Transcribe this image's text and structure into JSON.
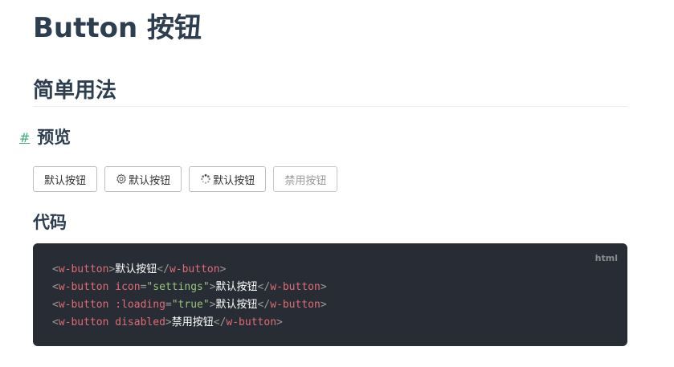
{
  "title": "Button 按钮",
  "section": {
    "heading": "简单用法",
    "preview": {
      "anchor": "#",
      "heading": "预览",
      "buttons": [
        {
          "label": "默认按钮",
          "icon": null,
          "disabled": false
        },
        {
          "label": "默认按钮",
          "icon": "settings-icon",
          "disabled": false
        },
        {
          "label": "默认按钮",
          "icon": "loading-icon",
          "disabled": false
        },
        {
          "label": "禁用按钮",
          "icon": null,
          "disabled": true
        }
      ]
    },
    "code": {
      "heading": "代码",
      "language": "html",
      "lines": [
        [
          {
            "t": "<",
            "k": "punct"
          },
          {
            "t": "w-button",
            "k": "tag"
          },
          {
            "t": ">",
            "k": "punct"
          },
          {
            "t": "默认按钮",
            "k": "text"
          },
          {
            "t": "</",
            "k": "punct"
          },
          {
            "t": "w-button",
            "k": "tag"
          },
          {
            "t": ">",
            "k": "punct"
          }
        ],
        [
          {
            "t": "<",
            "k": "punct"
          },
          {
            "t": "w-button",
            "k": "tag"
          },
          {
            "t": " ",
            "k": "text"
          },
          {
            "t": "icon",
            "k": "attr"
          },
          {
            "t": "=",
            "k": "punct"
          },
          {
            "t": "\"settings\"",
            "k": "str"
          },
          {
            "t": ">",
            "k": "punct"
          },
          {
            "t": "默认按钮",
            "k": "text"
          },
          {
            "t": "</",
            "k": "punct"
          },
          {
            "t": "w-button",
            "k": "tag"
          },
          {
            "t": ">",
            "k": "punct"
          }
        ],
        [
          {
            "t": "<",
            "k": "punct"
          },
          {
            "t": "w-button",
            "k": "tag"
          },
          {
            "t": " ",
            "k": "text"
          },
          {
            "t": ":loading",
            "k": "attr"
          },
          {
            "t": "=",
            "k": "punct"
          },
          {
            "t": "\"true\"",
            "k": "str"
          },
          {
            "t": ">",
            "k": "punct"
          },
          {
            "t": "默认按钮",
            "k": "text"
          },
          {
            "t": "</",
            "k": "punct"
          },
          {
            "t": "w-button",
            "k": "tag"
          },
          {
            "t": ">",
            "k": "punct"
          }
        ],
        [
          {
            "t": "<",
            "k": "punct"
          },
          {
            "t": "w-button",
            "k": "tag"
          },
          {
            "t": " ",
            "k": "text"
          },
          {
            "t": "disabled",
            "k": "attr"
          },
          {
            "t": ">",
            "k": "punct"
          },
          {
            "t": "禁用按钮",
            "k": "text"
          },
          {
            "t": "</",
            "k": "punct"
          },
          {
            "t": "w-button",
            "k": "tag"
          },
          {
            "t": ">",
            "k": "punct"
          }
        ]
      ]
    }
  },
  "colors": {
    "heading": "#2c3e50",
    "anchor": "#3eaf7c",
    "code_bg": "#282c34",
    "code_tag": "#e06c75",
    "code_string": "#98c379"
  }
}
